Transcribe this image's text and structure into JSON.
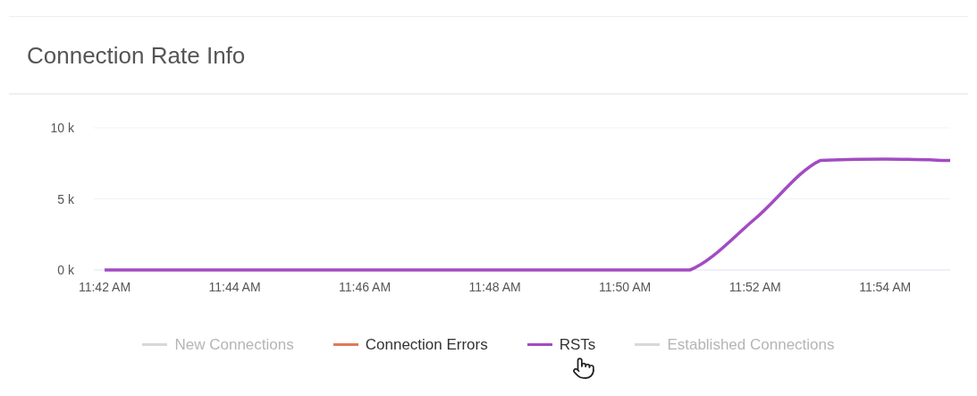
{
  "panel": {
    "title": "Connection Rate Info"
  },
  "chart": {
    "chart_data": {
      "type": "line",
      "categories": [
        "11:42 AM",
        null,
        "11:44 AM",
        null,
        "11:46 AM",
        null,
        "11:48 AM",
        null,
        "11:50 AM",
        null,
        "11:52 AM",
        null,
        "11:54 AM",
        null
      ],
      "ylim": [
        0,
        10000
      ],
      "yticks": [
        {
          "value": 0,
          "label": "0 k"
        },
        {
          "value": 5000,
          "label": "5 k"
        },
        {
          "value": 10000,
          "label": "10 k"
        }
      ],
      "series": [
        {
          "name": "RSTs",
          "color": "#a24cc2",
          "values": [
            0,
            0,
            0,
            0,
            0,
            0,
            0,
            0,
            0,
            0,
            3600,
            7700,
            7800,
            7700
          ]
        }
      ]
    },
    "legend": [
      {
        "kind": "label",
        "label": "New Connections",
        "color": "#d8d8d8",
        "enabled": false
      },
      {
        "kind": "label",
        "label": "Connection Errors",
        "color": "#e07a5a",
        "enabled": true
      },
      {
        "kind": "series",
        "enabled": true
      },
      {
        "kind": "label",
        "label": "Established Connections",
        "color": "#d8d8d8",
        "enabled": false
      }
    ]
  }
}
